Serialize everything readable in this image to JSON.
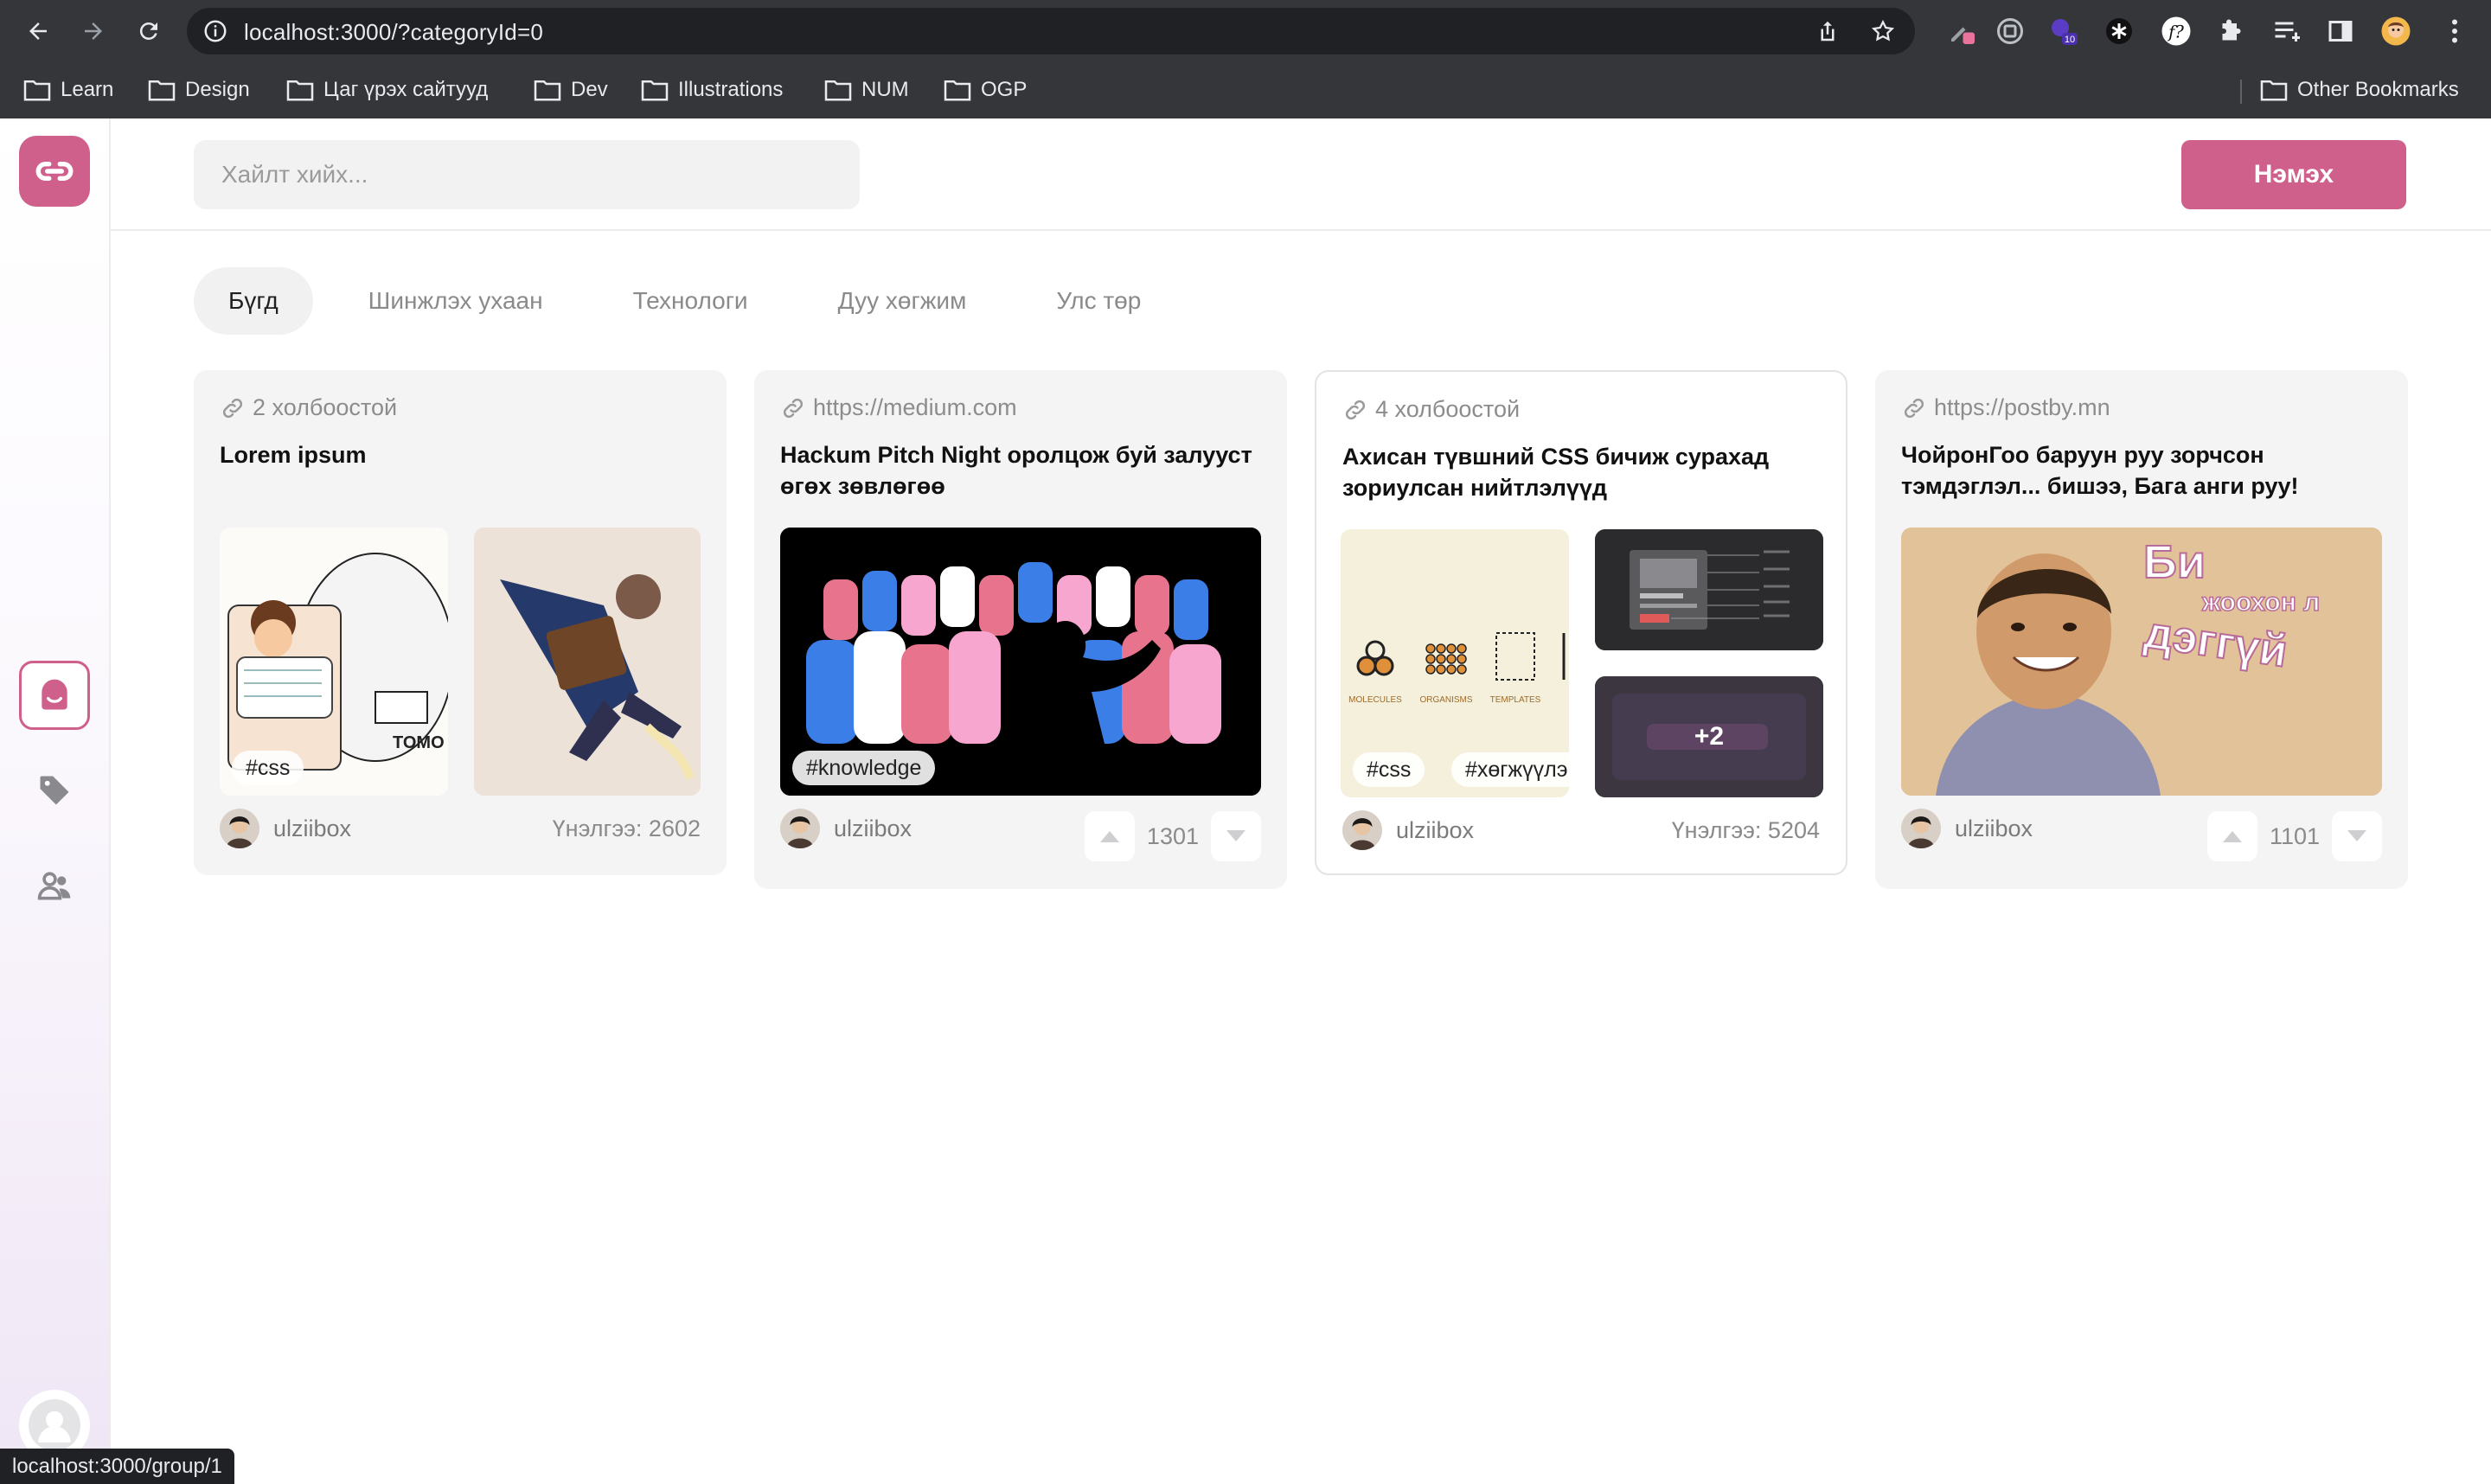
{
  "browser": {
    "url": "localhost:3000/?categoryId=0",
    "extension_badge": "10",
    "bookmarks": [
      "Learn",
      "Design",
      "Цаг үрэх сайтууд",
      "Dev",
      "Illustrations",
      "NUM",
      "OGP"
    ],
    "other_bookmarks": "Other Bookmarks",
    "status_url": "localhost:3000/group/1"
  },
  "topbar": {
    "search_placeholder": "Хайлт хийх...",
    "add_button": "Нэмэх"
  },
  "tabs": [
    {
      "label": "Бүгд",
      "active": true
    },
    {
      "label": "Шинжлэх ухаан",
      "active": false
    },
    {
      "label": "Технологи",
      "active": false
    },
    {
      "label": "Дуу хөгжим",
      "active": false
    },
    {
      "label": "Улс төр",
      "active": false
    }
  ],
  "cards": [
    {
      "meta": "2 холбоостой",
      "title": "Lorem ipsum",
      "tag": "#css",
      "author": "ulziibox",
      "views": "Үнэлгээ: 2602"
    },
    {
      "meta": "https://medium.com",
      "title": "Hackum Pitch Night оролцож буй залууст өгөх зөвлөгөө",
      "tag": "#knowledge",
      "author": "ulziibox",
      "votes": "1301"
    },
    {
      "meta": "4 холбоостой",
      "title": "Ахисан түвшний CSS бичиж сурахад зориулсан нийтлэлүүд",
      "tags": [
        "#css",
        "#хөгжүүлэгч"
      ],
      "more": "+2",
      "diagram_labels": [
        "MOLECULES",
        "ORGANISMS",
        "TEMPLATES"
      ],
      "author": "ulziibox",
      "views": "Үнэлгээ: 5204"
    },
    {
      "meta": "https://postby.mn",
      "title": "ЧойронГоо баруун руу зорчсон тэмдэглэл... бишээ, Бага анги руу!",
      "image_text": [
        "Би",
        "жоохон л",
        "дэггүй"
      ],
      "author": "ulziibox",
      "votes": "1101"
    }
  ],
  "colors": {
    "accent": "#cf5f8b",
    "chrome": "#35363a",
    "card_bg": "#f4f4f5"
  }
}
